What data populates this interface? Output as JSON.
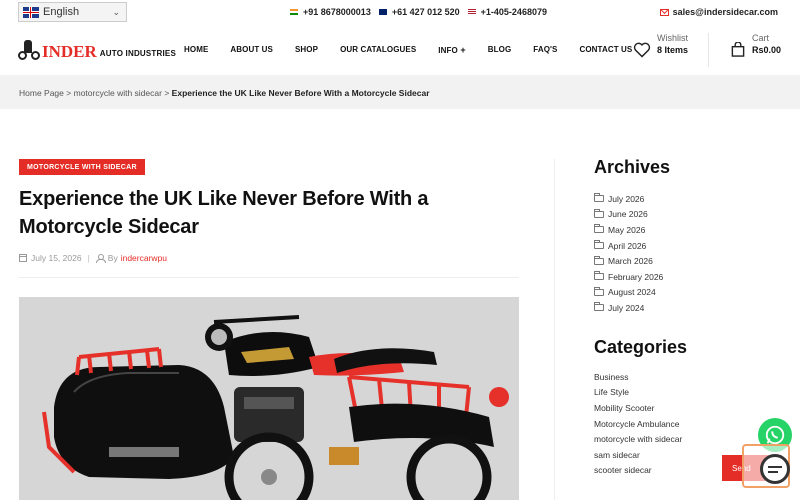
{
  "topbar": {
    "language": "English",
    "phones": [
      {
        "flag": "india-flag",
        "number": "+91 8678000013"
      },
      {
        "flag": "australia-flag",
        "number": "+61 427 012 520"
      },
      {
        "flag": "usa-flag",
        "number": "+1-405-2468079"
      }
    ],
    "email": "sales@indersidecar.com"
  },
  "header": {
    "logo_main": "INDER",
    "logo_sub": "AUTO INDUSTRIES",
    "nav": [
      "HOME",
      "ABOUT US",
      "SHOP",
      "OUR CATALOGUES",
      "INFO",
      "BLOG",
      "FAQ'S",
      "CONTACT US"
    ],
    "wishlist_label": "Wishlist",
    "wishlist_count": "8 Items",
    "cart_label": "Cart",
    "cart_amount": "Rs0.00"
  },
  "breadcrumb": {
    "home": "Home Page",
    "sep": ">",
    "category": "motorcycle with sidecar",
    "current": "Experience the UK Like Never Before With a Motorcycle Sidecar"
  },
  "post": {
    "category_badge": "MOTORCYCLE WITH SIDECAR",
    "title": "Experience the UK Like Never Before With a Motorcycle Sidecar",
    "date": "July 15, 2026",
    "by": "By",
    "author": "indercarwpu"
  },
  "sidebar": {
    "archives_title": "Archives",
    "archives": [
      "July 2026",
      "June 2026",
      "May 2026",
      "April 2026",
      "March 2026",
      "February 2026",
      "August 2024",
      "July 2024"
    ],
    "categories_title": "Categories",
    "categories": [
      "Business",
      "Life Style",
      "Mobility Scooter",
      "Motorcycle Ambulance",
      "motorcycle with sidecar",
      "sam sidecar",
      "scooter sidecar"
    ]
  },
  "floating": {
    "send_label": "Send"
  },
  "colors": {
    "accent": "#e52d27",
    "whatsapp": "#25d366",
    "breadcrumb_bg": "#f2f2f2"
  }
}
